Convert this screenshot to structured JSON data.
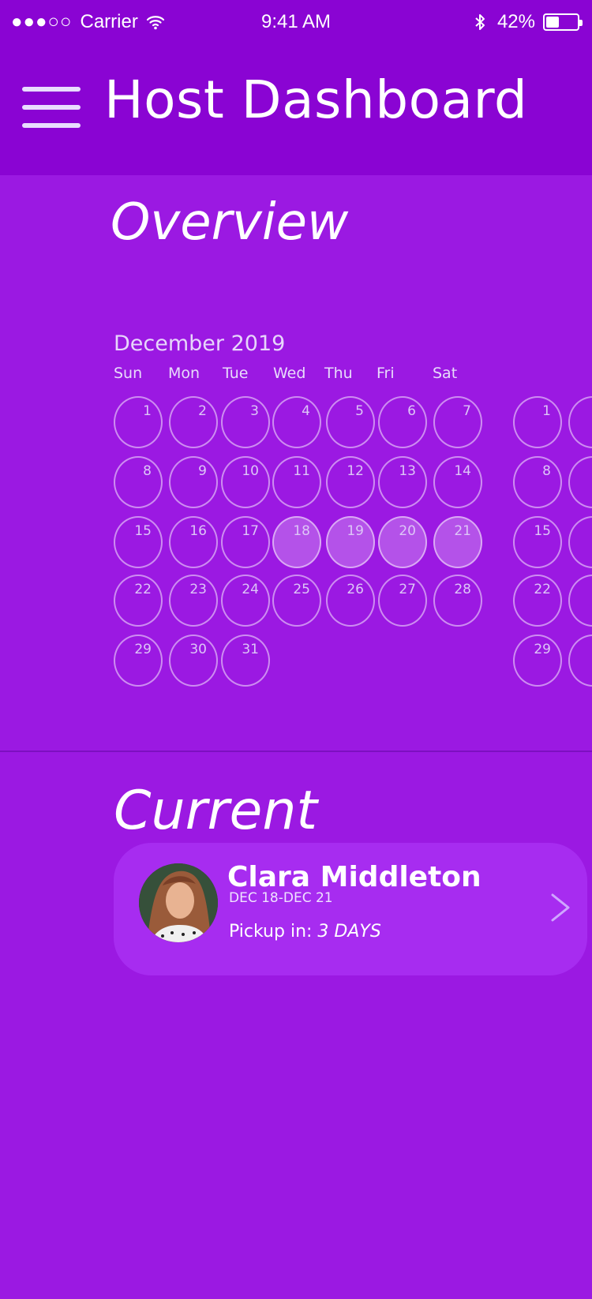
{
  "status_bar": {
    "signal": "●●●○○",
    "carrier": "Carrier",
    "time": "9:41 AM",
    "battery_percent": "42%",
    "battery_level": 0.42
  },
  "header": {
    "title": "Host Dashboard",
    "menu_icon": "hamburger-menu-icon"
  },
  "overview": {
    "title": "Overview",
    "calendar": {
      "month_label": "December 2019",
      "weekdays": [
        "Sun",
        "Mon",
        "Tue",
        "Wed",
        "Thu",
        "Fri",
        "Sat"
      ],
      "days": [
        "1",
        "2",
        "3",
        "4",
        "5",
        "6",
        "7",
        "8",
        "9",
        "10",
        "11",
        "12",
        "13",
        "14",
        "15",
        "16",
        "17",
        "18",
        "19",
        "20",
        "21",
        "22",
        "23",
        "24",
        "25",
        "26",
        "27",
        "28",
        "29",
        "30",
        "31"
      ],
      "selected_days": [
        "18",
        "19",
        "20",
        "21"
      ]
    },
    "next_calendar": {
      "days": [
        "1",
        "8",
        "15",
        "22",
        "29"
      ]
    }
  },
  "current": {
    "title": "Current",
    "booking": {
      "name": "Clara Middleton",
      "dates": "DEC 18-DEC 21",
      "pickup_label": "Pickup in: ",
      "pickup_value": "3 DAYS",
      "avatar_icon": "avatar",
      "chevron_icon": "chevron-right-icon"
    }
  }
}
